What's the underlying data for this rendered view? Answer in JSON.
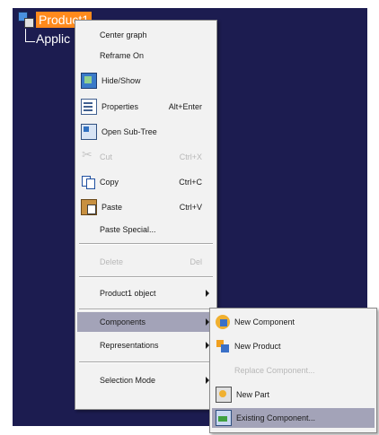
{
  "tree": {
    "root_label": "Product1",
    "child_label": "Applic"
  },
  "context_menu": {
    "items": [
      {
        "label": "Center graph",
        "shortcut": "",
        "icon": ""
      },
      {
        "label": "Reframe On",
        "shortcut": "",
        "icon": ""
      },
      {
        "label": "Hide/Show",
        "shortcut": "",
        "icon": "hide-show-icon"
      },
      {
        "label": "Properties",
        "shortcut": "Alt+Enter",
        "icon": "properties-icon"
      },
      {
        "label": "Open Sub-Tree",
        "shortcut": "",
        "icon": "open-subtree-icon"
      },
      {
        "label": "Cut",
        "shortcut": "Ctrl+X",
        "icon": "cut-icon"
      },
      {
        "label": "Copy",
        "shortcut": "Ctrl+C",
        "icon": "copy-icon"
      },
      {
        "label": "Paste",
        "shortcut": "Ctrl+V",
        "icon": "paste-icon"
      },
      {
        "label": "Paste Special...",
        "shortcut": "",
        "icon": ""
      },
      {
        "label": "Delete",
        "shortcut": "Del",
        "icon": ""
      },
      {
        "label": "Product1 object",
        "shortcut": "",
        "icon": ""
      },
      {
        "label": "Components",
        "shortcut": "",
        "icon": ""
      },
      {
        "label": "Representations",
        "shortcut": "",
        "icon": ""
      },
      {
        "label": "Selection Mode",
        "shortcut": "",
        "icon": ""
      }
    ]
  },
  "components_submenu": {
    "items": [
      {
        "label": "New Component",
        "icon": "new-component-icon"
      },
      {
        "label": "New Product",
        "icon": "new-product-icon"
      },
      {
        "label": "Replace Component...",
        "icon": ""
      },
      {
        "label": "New Part",
        "icon": "new-part-icon"
      },
      {
        "label": "Existing Component...",
        "icon": "existing-component-icon"
      }
    ]
  },
  "colors": {
    "background": "#1c1c50",
    "selection": "#ff8a1c",
    "menu_highlight": "#a3a3b8"
  }
}
